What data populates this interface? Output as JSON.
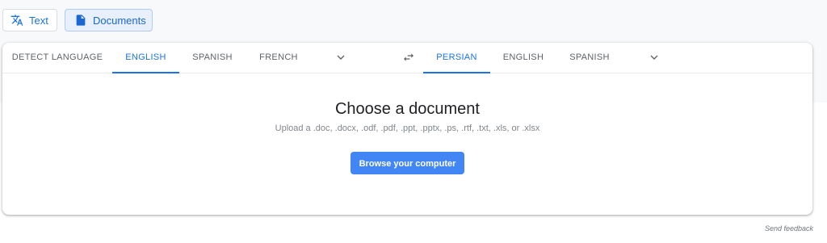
{
  "mode_tabs": {
    "text_label": "Text",
    "text_icon": "translate-icon",
    "documents_label": "Documents",
    "documents_icon": "document-icon"
  },
  "source_languages": {
    "tabs": [
      "DETECT LANGUAGE",
      "ENGLISH",
      "SPANISH",
      "FRENCH"
    ],
    "active": "ENGLISH",
    "more_icon": "chevron-down-icon"
  },
  "swap_icon": "swap-arrows-icon",
  "target_languages": {
    "tabs": [
      "PERSIAN",
      "ENGLISH",
      "SPANISH"
    ],
    "active": "PERSIAN",
    "more_icon": "chevron-down-icon"
  },
  "document_panel": {
    "title": "Choose a document",
    "subtitle": "Upload a .doc, .docx, .odf, .pdf, .ppt, .pptx, .ps, .rtf, .txt, .xls, or .xlsx",
    "browse_label": "Browse your computer"
  },
  "footer": {
    "feedback_label": "Send feedback"
  },
  "colors": {
    "accent": "#1a73e8",
    "button_blue": "#4285f4"
  }
}
